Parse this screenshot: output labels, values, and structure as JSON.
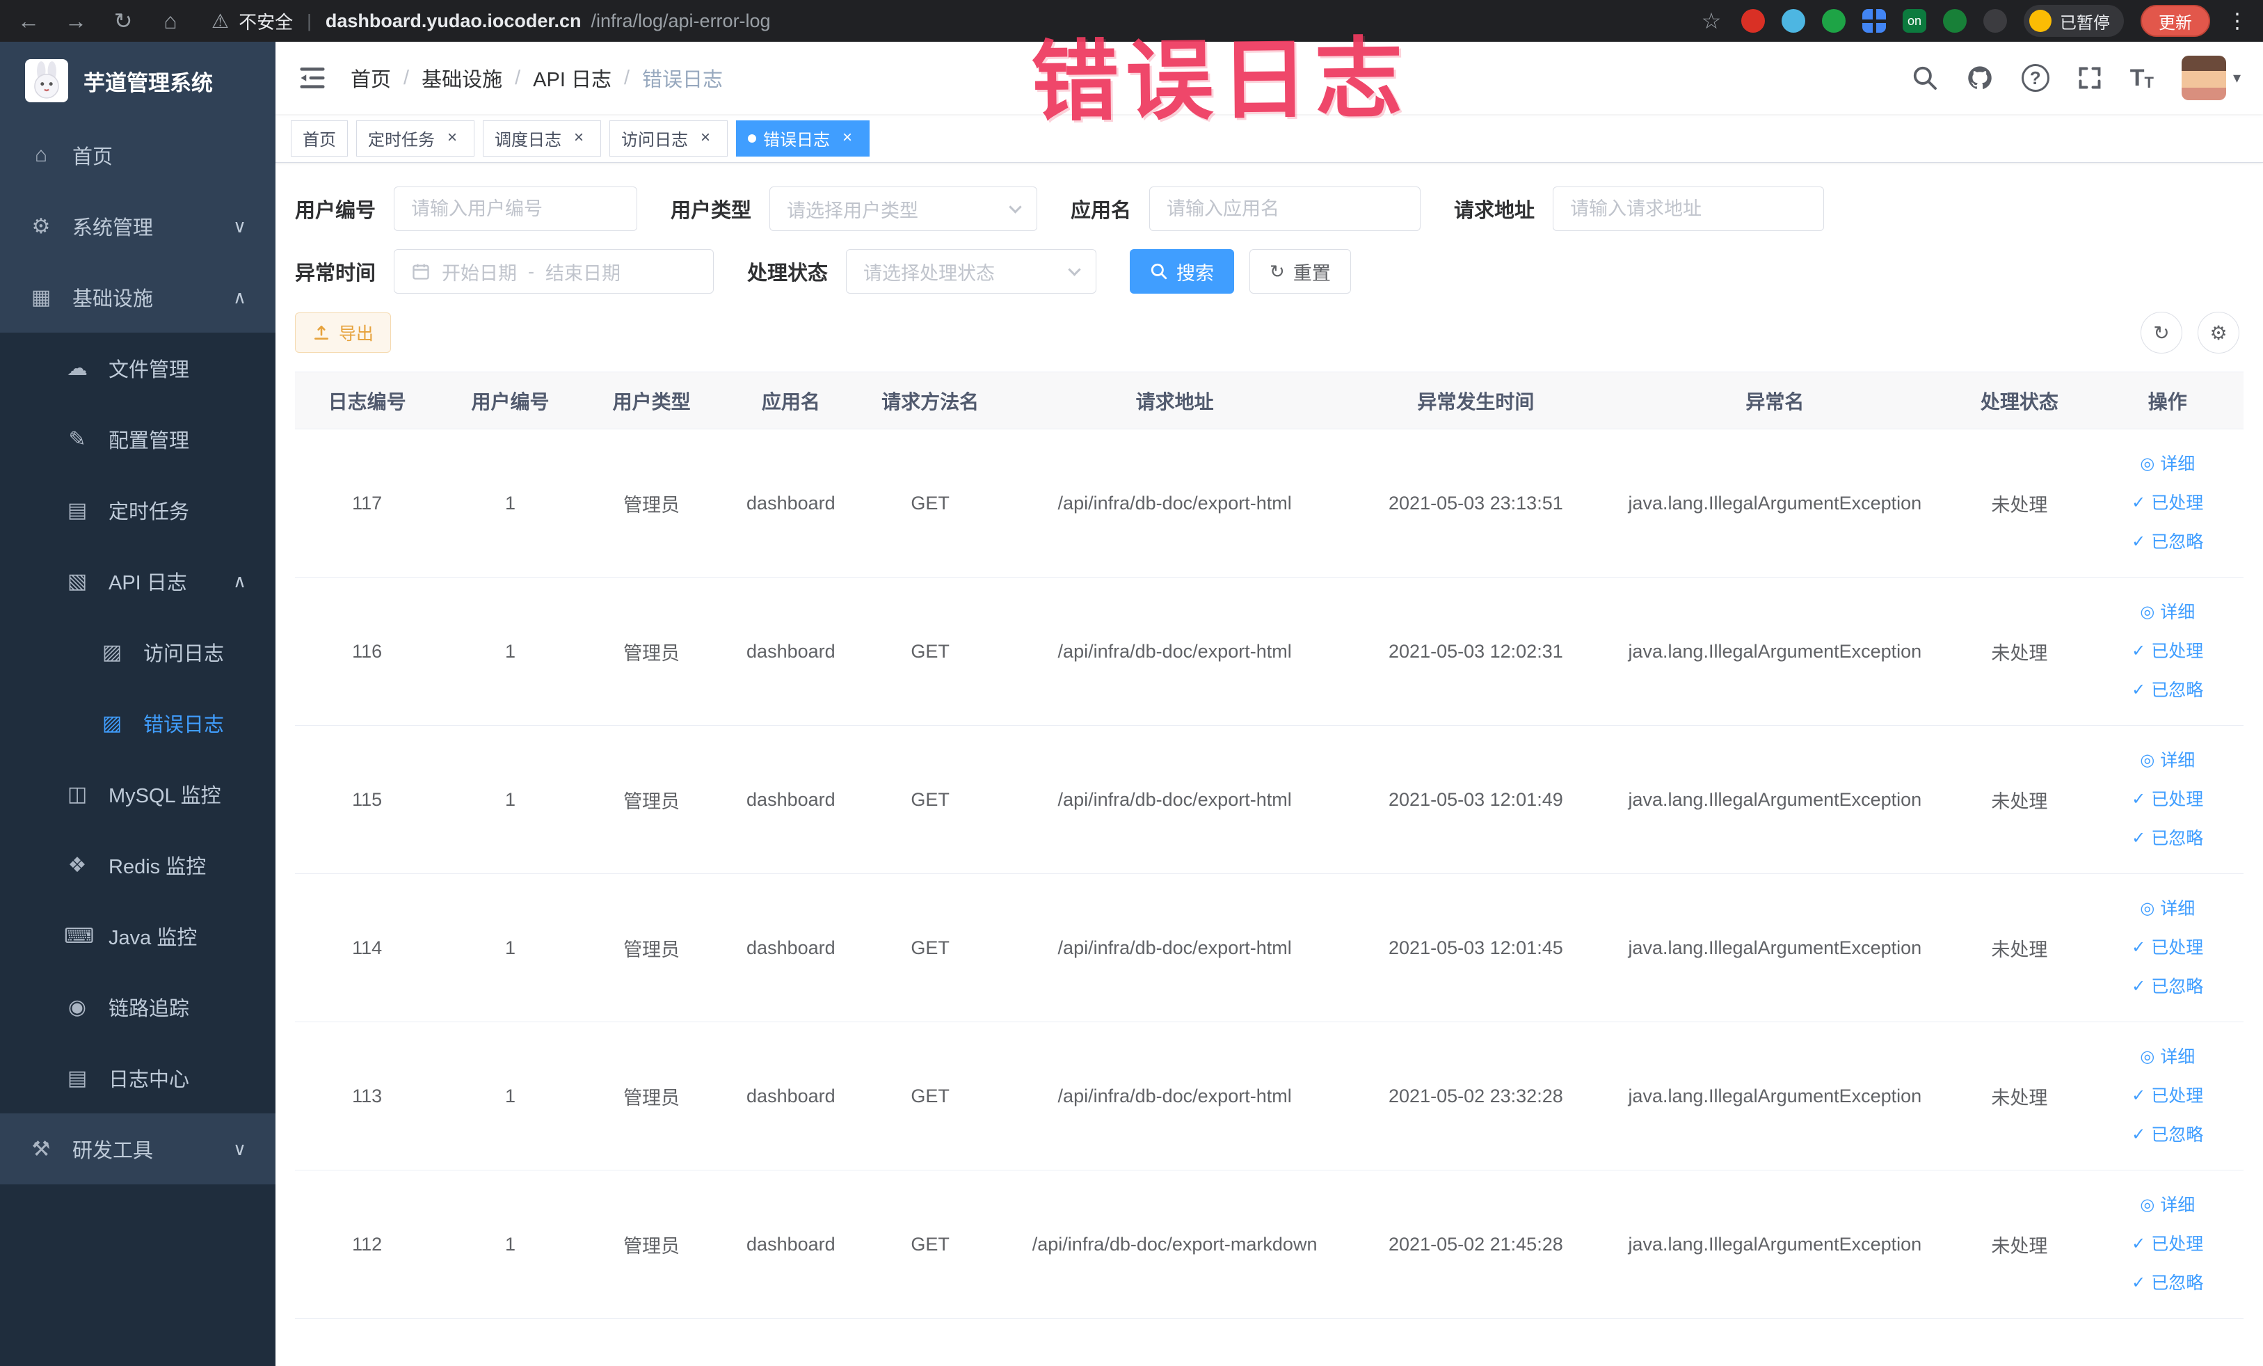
{
  "colors": {
    "primary": "#409eff",
    "warning": "#e6a23c",
    "annotation": "#ee3a5f",
    "sidebar_bg": "#304156",
    "sidebar_sub_bg": "#1f2d3d",
    "chrome_bg": "#202124"
  },
  "icons": {
    "back": "←",
    "forward": "→",
    "reload": "↻",
    "home": "⌂",
    "warning": "⚠",
    "star": "☆",
    "kebab": "⋮",
    "question": "?",
    "caret_down": "▾",
    "close": "×",
    "chevron_down": "∨",
    "chevron_up": "∧",
    "menu_home": "⌂",
    "menu_gear": "⚙",
    "menu_grid": "▦",
    "menu_cloud": "☁",
    "menu_edit": "✎",
    "menu_list": "▤",
    "menu_doc": "▧",
    "menu_log": "▨",
    "menu_db": "◫",
    "menu_redis": "❖",
    "menu_java": "⌨",
    "menu_eye": "◉",
    "menu_center": "▤",
    "menu_tools": "⚒",
    "gear": "⚙",
    "eye": "◎",
    "check": "✓"
  },
  "browser": {
    "security_label": "不安全",
    "url_host": "dashboard.yudao.iocoder.cn",
    "url_path": "/infra/log/api-error-log",
    "on_badge": "on",
    "paused_badge": "已暂停",
    "update_button": "更新"
  },
  "annotation": {
    "text": "错误日志"
  },
  "sidebar": {
    "logo_title": "芋道管理系统",
    "items": [
      {
        "label": "首页"
      },
      {
        "label": "系统管理"
      },
      {
        "label": "基础设施"
      },
      {
        "label": "文件管理"
      },
      {
        "label": "配置管理"
      },
      {
        "label": "定时任务"
      },
      {
        "label": "API 日志"
      },
      {
        "label": "访问日志"
      },
      {
        "label": "错误日志"
      },
      {
        "label": "MySQL 监控"
      },
      {
        "label": "Redis 监控"
      },
      {
        "label": "Java 监控"
      },
      {
        "label": "链路追踪"
      },
      {
        "label": "日志中心"
      },
      {
        "label": "研发工具"
      }
    ]
  },
  "header": {
    "breadcrumb": [
      "首页",
      "基础设施",
      "API 日志",
      "错误日志"
    ]
  },
  "tabs": [
    {
      "label": "首页"
    },
    {
      "label": "定时任务"
    },
    {
      "label": "调度日志"
    },
    {
      "label": "访问日志"
    },
    {
      "label": "错误日志"
    }
  ],
  "filters": {
    "user_id": {
      "label": "用户编号",
      "placeholder": "请输入用户编号"
    },
    "user_type": {
      "label": "用户类型",
      "placeholder": "请选择用户类型"
    },
    "app_name": {
      "label": "应用名",
      "placeholder": "请输入应用名"
    },
    "request_url": {
      "label": "请求地址",
      "placeholder": "请输入请求地址"
    },
    "exception_time": {
      "label": "异常时间",
      "start_placeholder": "开始日期",
      "end_placeholder": "结束日期",
      "range_separator": "-"
    },
    "process_status": {
      "label": "处理状态",
      "placeholder": "请选择处理状态"
    },
    "search_button": "搜索",
    "reset_button": "重置"
  },
  "toolbar": {
    "export_button": "导出"
  },
  "table": {
    "columns": [
      "日志编号",
      "用户编号",
      "用户类型",
      "应用名",
      "请求方法名",
      "请求地址",
      "异常发生时间",
      "异常名",
      "处理状态",
      "操作"
    ],
    "actions": [
      "详细",
      "已处理",
      "已忽略"
    ],
    "rows": [
      {
        "id": "117",
        "user_id": "1",
        "user_type": "管理员",
        "app": "dashboard",
        "method": "GET",
        "url": "/api/infra/db-doc/export-html",
        "time": "2021-05-03 23:13:51",
        "exception": "java.lang.IllegalArgumentException",
        "status": "未处理"
      },
      {
        "id": "116",
        "user_id": "1",
        "user_type": "管理员",
        "app": "dashboard",
        "method": "GET",
        "url": "/api/infra/db-doc/export-html",
        "time": "2021-05-03 12:02:31",
        "exception": "java.lang.IllegalArgumentException",
        "status": "未处理"
      },
      {
        "id": "115",
        "user_id": "1",
        "user_type": "管理员",
        "app": "dashboard",
        "method": "GET",
        "url": "/api/infra/db-doc/export-html",
        "time": "2021-05-03 12:01:49",
        "exception": "java.lang.IllegalArgumentException",
        "status": "未处理"
      },
      {
        "id": "114",
        "user_id": "1",
        "user_type": "管理员",
        "app": "dashboard",
        "method": "GET",
        "url": "/api/infra/db-doc/export-html",
        "time": "2021-05-03 12:01:45",
        "exception": "java.lang.IllegalArgumentException",
        "status": "未处理"
      },
      {
        "id": "113",
        "user_id": "1",
        "user_type": "管理员",
        "app": "dashboard",
        "method": "GET",
        "url": "/api/infra/db-doc/export-html",
        "time": "2021-05-02 23:32:28",
        "exception": "java.lang.IllegalArgumentException",
        "status": "未处理"
      },
      {
        "id": "112",
        "user_id": "1",
        "user_type": "管理员",
        "app": "dashboard",
        "method": "GET",
        "url": "/api/infra/db-doc/export-markdown",
        "time": "2021-05-02 21:45:28",
        "exception": "java.lang.IllegalArgumentException",
        "status": "未处理"
      }
    ]
  }
}
